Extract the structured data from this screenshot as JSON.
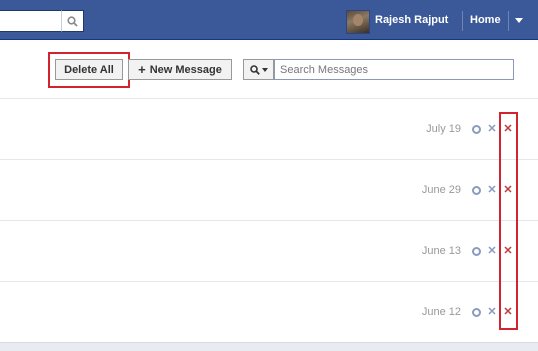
{
  "topbar": {
    "user_name": "Rajesh Rajput",
    "home_label": "Home",
    "icons": [
      "search-icon",
      "avatar",
      "account-menu-arrow-icon"
    ]
  },
  "toolbar": {
    "delete_all_label": "Delete All",
    "new_message_label": "New Message",
    "new_message_icon": "+",
    "search_placeholder": "Search Messages"
  },
  "messages": [
    {
      "date": "July 19"
    },
    {
      "date": "June 29"
    },
    {
      "date": "June 13"
    },
    {
      "date": "June 12"
    }
  ],
  "row_actions": [
    "mark-read-icon",
    "archive-icon",
    "delete-icon"
  ],
  "colors": {
    "topbar_bg": "#3b5998",
    "highlight": "#d1242f",
    "delete_icon": "#c23b3b",
    "archive_icon": "#8a9ac0"
  }
}
